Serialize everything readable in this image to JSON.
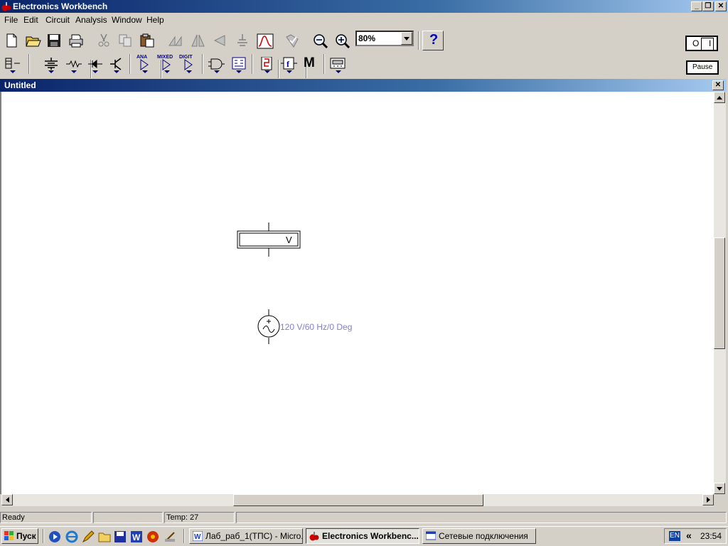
{
  "app": {
    "title": "Electronics Workbench",
    "window_buttons": [
      "_",
      "❐",
      "✕"
    ]
  },
  "menu": [
    "File",
    "Edit",
    "Circuit",
    "Analysis",
    "Window",
    "Help"
  ],
  "toolbar": {
    "zoom_value": "80%",
    "help_label": "?",
    "power_switch": {
      "off": "O",
      "on": "I"
    },
    "pause_label": "Pause",
    "parts_labels": {
      "analog": "ANA",
      "mixed": "MIXED",
      "digital": "DIGIT",
      "misc": "M"
    }
  },
  "circuit_window": {
    "title": "Untitled",
    "close_label": "✕",
    "voltmeter_label": "V",
    "source_label": "120 V/60 Hz/0 Deg"
  },
  "statusbar": {
    "status": "Ready",
    "middle": "",
    "temp": "Temp:  27"
  },
  "taskbar": {
    "start": "Пуск",
    "buttons": [
      "Лаб_раб_1(ТПС) - Micro...",
      "Electronics Workbenc...",
      "Сетевые подключения"
    ],
    "language": "EN",
    "chevron": "«",
    "clock": "23:54"
  }
}
